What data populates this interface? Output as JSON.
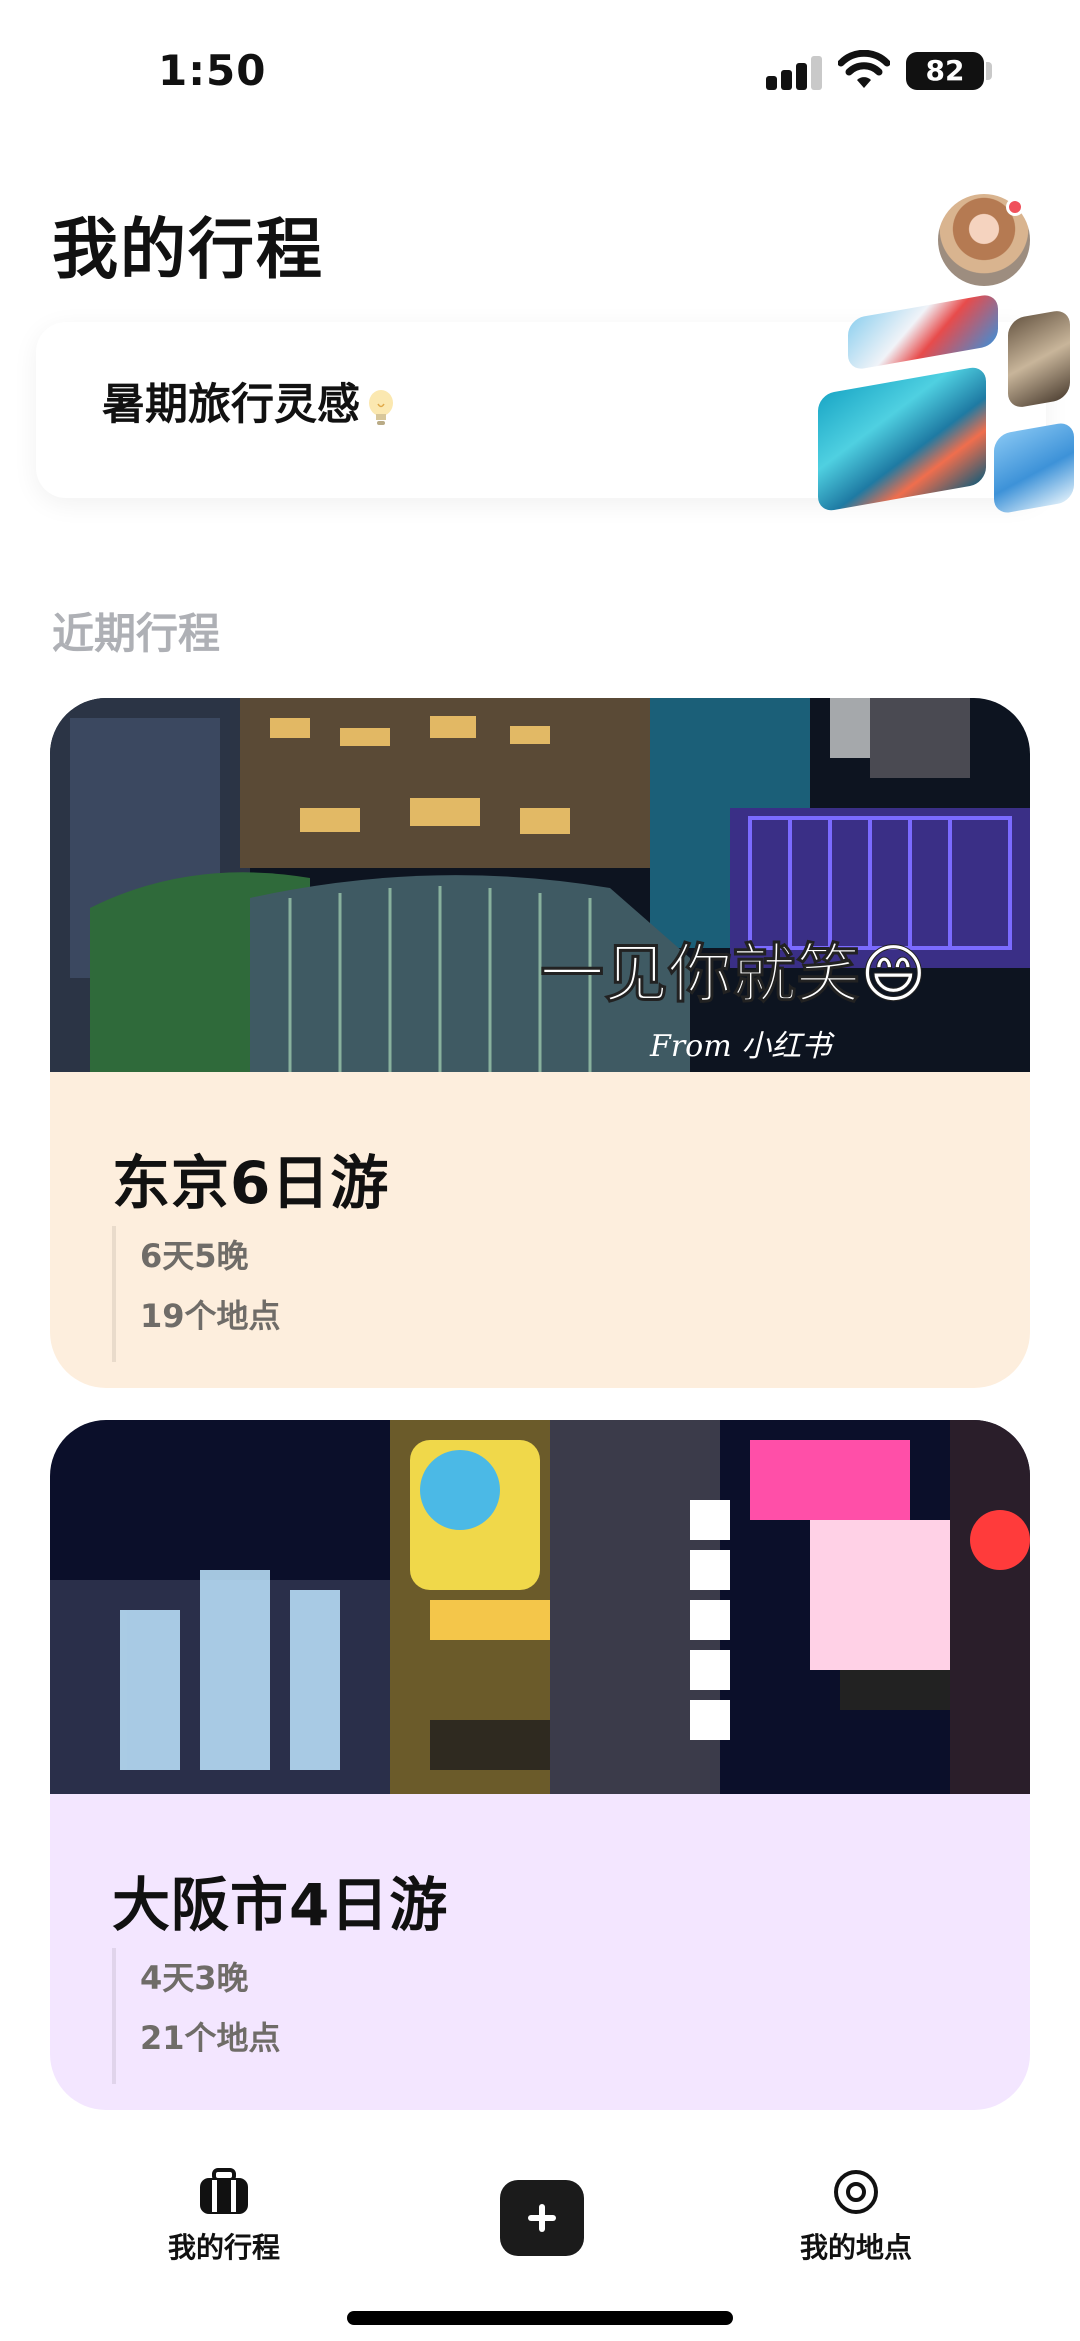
{
  "status_bar": {
    "time": "1:50",
    "battery_percent": "82",
    "battery_level": 0.82,
    "signal_bars_active": 3,
    "signal_bars_total": 4
  },
  "header": {
    "title": "我的行程"
  },
  "inspiration": {
    "label": "暑期旅行灵感"
  },
  "recent": {
    "section_title": "近期行程",
    "trips": [
      {
        "title": "东京6日游",
        "duration": "6天5晚",
        "places": "19个地点",
        "card_color": "#fdeedd",
        "photo_caption": "一见你就笑😄",
        "photo_watermark": "From 小红书"
      },
      {
        "title": "大阪市4日游",
        "duration": "4天3晚",
        "places": "21个地点",
        "card_color": "#f3e6ff"
      }
    ]
  },
  "tab_bar": {
    "items": [
      {
        "label": "我的行程",
        "icon": "suitcase-icon"
      },
      {
        "label": "",
        "icon": "plus-icon"
      },
      {
        "label": "我的地点",
        "icon": "location-pin-icon"
      }
    ]
  },
  "colors": {
    "accent_dark": "#1b1b1b",
    "section_gray": "#aeb0b5",
    "notification_red": "#f0515c"
  }
}
